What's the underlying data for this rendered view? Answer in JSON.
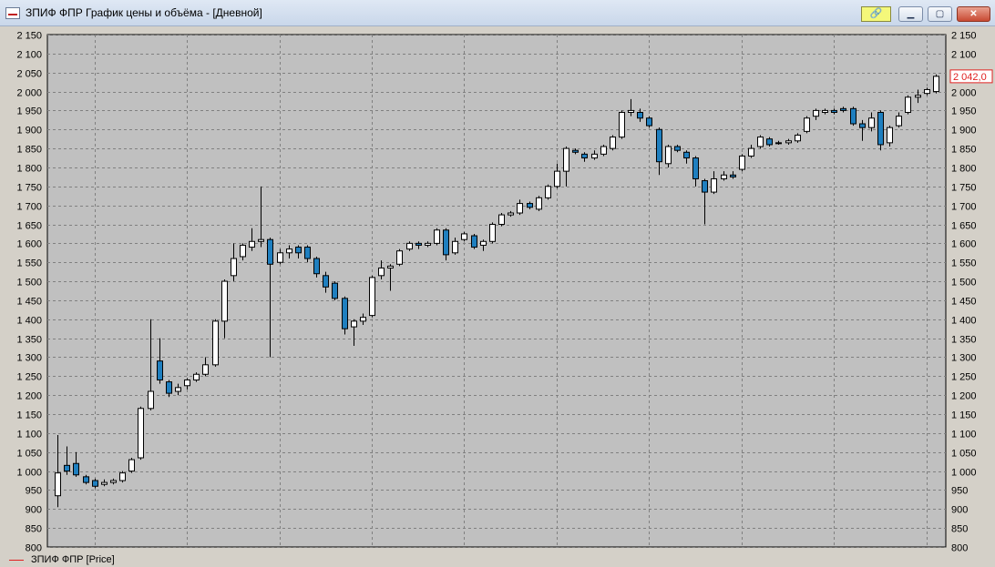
{
  "window": {
    "title": "ЗПИФ ФПР График цены и объёма - [Дневной]",
    "buttons": {
      "link": "🔗",
      "minimize": "▁",
      "maximize": "▢",
      "close": "✕"
    }
  },
  "legend": {
    "label": "ЗПИФ ФПР [Price]",
    "color": "#e02020"
  },
  "last_price_label": "2 042,0",
  "colors": {
    "background": "#c0c0c0",
    "up": "#ffffff",
    "down": "#1f7fbf",
    "grid": "#808080",
    "price_label": "#e02020"
  },
  "chart_data": {
    "type": "candlestick",
    "ylim": [
      800,
      2150
    ],
    "y_ticks": [
      "2 150",
      "2 100",
      "2 050",
      "2 000",
      "1 950",
      "1 900",
      "1 850",
      "1 800",
      "1 750",
      "1 700",
      "1 650",
      "1 600",
      "1 550",
      "1 500",
      "1 450",
      "1 400",
      "1 350",
      "1 300",
      "1 250",
      "1 200",
      "1 150",
      "1 100",
      "1 050",
      "1 000",
      "950",
      "900",
      "850",
      "800"
    ],
    "grid": true,
    "candles": [
      [
        935,
        995,
        905,
        1095
      ],
      [
        1015,
        1000,
        990,
        1065
      ],
      [
        1020,
        990,
        985,
        1050
      ],
      [
        985,
        970,
        965,
        990
      ],
      [
        975,
        960,
        955,
        980
      ],
      [
        965,
        970,
        960,
        978
      ],
      [
        970,
        975,
        965,
        980
      ],
      [
        975,
        995,
        970,
        1000
      ],
      [
        1000,
        1030,
        995,
        1035
      ],
      [
        1035,
        1165,
        1030,
        1170
      ],
      [
        1165,
        1210,
        1160,
        1400
      ],
      [
        1290,
        1240,
        1230,
        1350
      ],
      [
        1235,
        1205,
        1195,
        1240
      ],
      [
        1210,
        1220,
        1200,
        1230
      ],
      [
        1225,
        1240,
        1215,
        1245
      ],
      [
        1240,
        1255,
        1235,
        1260
      ],
      [
        1255,
        1280,
        1250,
        1300
      ],
      [
        1280,
        1395,
        1275,
        1400
      ],
      [
        1395,
        1500,
        1350,
        1505
      ],
      [
        1515,
        1560,
        1500,
        1600
      ],
      [
        1565,
        1595,
        1555,
        1600
      ],
      [
        1590,
        1605,
        1580,
        1640
      ],
      [
        1605,
        1610,
        1590,
        1750
      ],
      [
        1610,
        1545,
        1300,
        1615
      ],
      [
        1550,
        1575,
        1545,
        1585
      ],
      [
        1575,
        1585,
        1560,
        1595
      ],
      [
        1590,
        1575,
        1560,
        1595
      ],
      [
        1590,
        1560,
        1550,
        1595
      ],
      [
        1560,
        1520,
        1510,
        1565
      ],
      [
        1515,
        1485,
        1470,
        1525
      ],
      [
        1495,
        1455,
        1450,
        1500
      ],
      [
        1455,
        1375,
        1360,
        1460
      ],
      [
        1380,
        1395,
        1330,
        1400
      ],
      [
        1395,
        1405,
        1385,
        1415
      ],
      [
        1410,
        1510,
        1405,
        1515
      ],
      [
        1515,
        1535,
        1505,
        1555
      ],
      [
        1535,
        1540,
        1475,
        1545
      ],
      [
        1545,
        1580,
        1540,
        1585
      ],
      [
        1585,
        1600,
        1580,
        1605
      ],
      [
        1600,
        1595,
        1585,
        1605
      ],
      [
        1595,
        1600,
        1590,
        1605
      ],
      [
        1600,
        1635,
        1595,
        1640
      ],
      [
        1635,
        1570,
        1555,
        1640
      ],
      [
        1575,
        1605,
        1570,
        1615
      ],
      [
        1610,
        1625,
        1605,
        1630
      ],
      [
        1620,
        1590,
        1585,
        1625
      ],
      [
        1595,
        1605,
        1580,
        1610
      ],
      [
        1605,
        1650,
        1600,
        1655
      ],
      [
        1650,
        1675,
        1645,
        1680
      ],
      [
        1675,
        1680,
        1670,
        1685
      ],
      [
        1680,
        1705,
        1675,
        1715
      ],
      [
        1705,
        1695,
        1690,
        1710
      ],
      [
        1690,
        1720,
        1685,
        1725
      ],
      [
        1720,
        1750,
        1715,
        1755
      ],
      [
        1750,
        1790,
        1745,
        1810
      ],
      [
        1790,
        1850,
        1750,
        1855
      ],
      [
        1845,
        1840,
        1835,
        1850
      ],
      [
        1835,
        1825,
        1815,
        1840
      ],
      [
        1825,
        1835,
        1820,
        1845
      ],
      [
        1835,
        1855,
        1830,
        1860
      ],
      [
        1850,
        1880,
        1845,
        1885
      ],
      [
        1880,
        1945,
        1875,
        1950
      ],
      [
        1945,
        1950,
        1935,
        1980
      ],
      [
        1945,
        1930,
        1920,
        1955
      ],
      [
        1930,
        1910,
        1905,
        1935
      ],
      [
        1900,
        1815,
        1780,
        1905
      ],
      [
        1810,
        1855,
        1800,
        1860
      ],
      [
        1855,
        1845,
        1840,
        1860
      ],
      [
        1840,
        1825,
        1810,
        1845
      ],
      [
        1825,
        1770,
        1750,
        1830
      ],
      [
        1765,
        1735,
        1650,
        1770
      ],
      [
        1735,
        1770,
        1730,
        1790
      ],
      [
        1770,
        1780,
        1765,
        1790
      ],
      [
        1780,
        1775,
        1770,
        1790
      ],
      [
        1795,
        1830,
        1790,
        1835
      ],
      [
        1830,
        1850,
        1825,
        1860
      ],
      [
        1855,
        1880,
        1850,
        1885
      ],
      [
        1875,
        1860,
        1855,
        1880
      ],
      [
        1865,
        1865,
        1860,
        1870
      ],
      [
        1865,
        1870,
        1860,
        1875
      ],
      [
        1870,
        1885,
        1865,
        1890
      ],
      [
        1895,
        1930,
        1890,
        1935
      ],
      [
        1935,
        1950,
        1925,
        1955
      ],
      [
        1945,
        1950,
        1940,
        1955
      ],
      [
        1950,
        1945,
        1940,
        1955
      ],
      [
        1955,
        1950,
        1945,
        1960
      ],
      [
        1955,
        1915,
        1910,
        1960
      ],
      [
        1915,
        1905,
        1870,
        1925
      ],
      [
        1905,
        1930,
        1895,
        1945
      ],
      [
        1945,
        1860,
        1845,
        1950
      ],
      [
        1865,
        1905,
        1855,
        1910
      ],
      [
        1910,
        1935,
        1905,
        1945
      ],
      [
        1945,
        1985,
        1940,
        1990
      ],
      [
        1985,
        1990,
        1970,
        2005
      ],
      [
        1995,
        2005,
        1990,
        2010
      ],
      [
        2000,
        2040,
        1995,
        2045
      ]
    ]
  }
}
